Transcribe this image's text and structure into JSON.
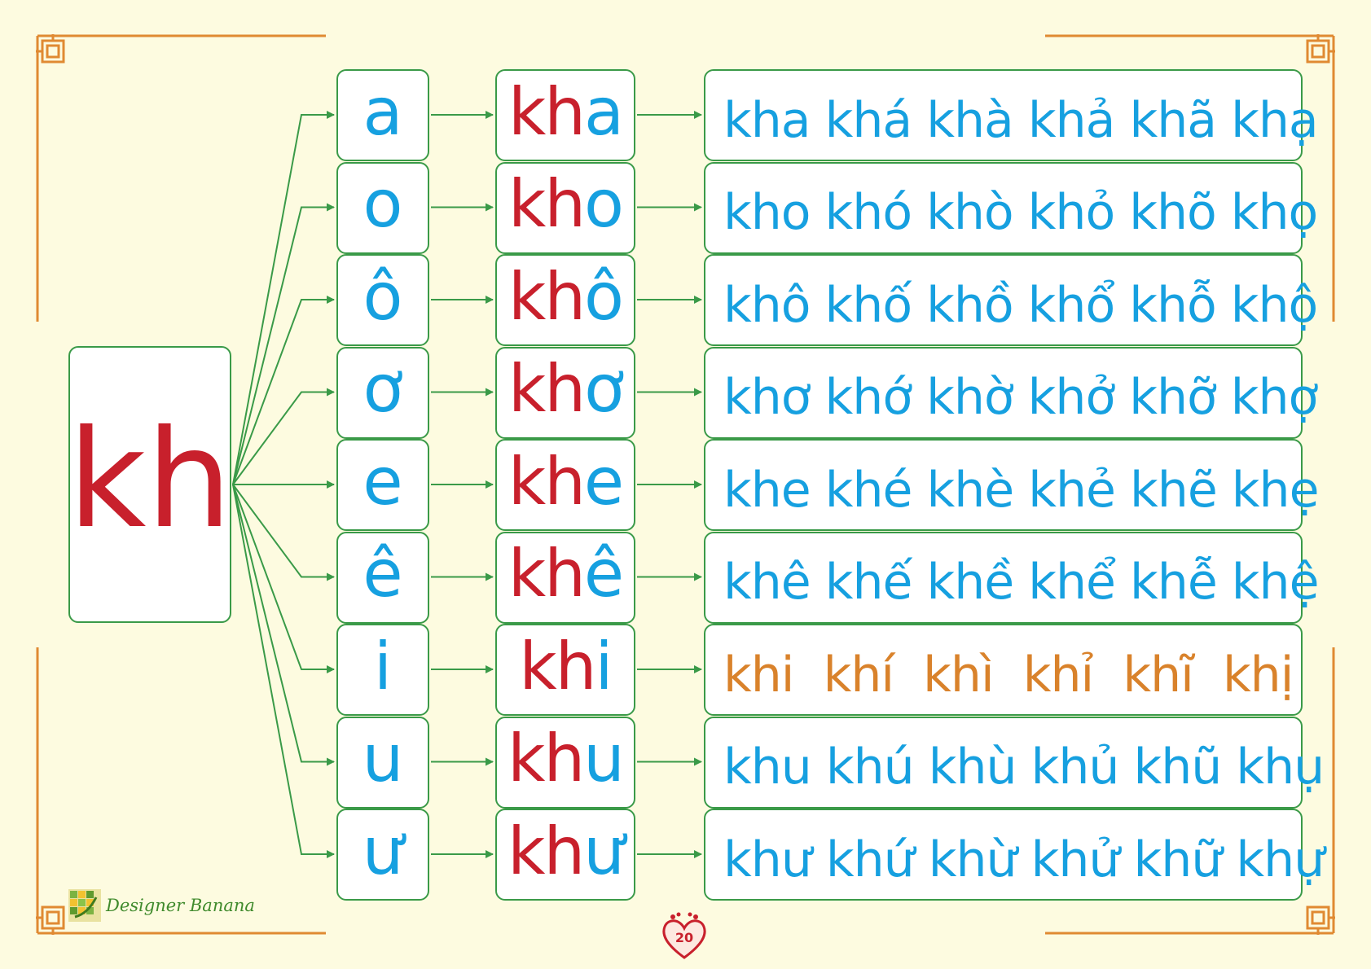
{
  "colors": {
    "background": "#fdfbe0",
    "consonant_red": "#c8202c",
    "vowel_blue": "#16a0e0",
    "highlight_orange": "#d9822b",
    "border_green": "#3a9a48",
    "frame_orange": "#e08a32"
  },
  "consonant": "kh",
  "rows": [
    {
      "vowel": "a",
      "syllable_kh": "kh",
      "syllable_vowel": "a",
      "tones": "kha khá khà khả khã khạ",
      "color": "#16a0e0"
    },
    {
      "vowel": "o",
      "syllable_kh": "kh",
      "syllable_vowel": "o",
      "tones": "kho khó khò khỏ khõ khọ",
      "color": "#16a0e0"
    },
    {
      "vowel": "ô",
      "syllable_kh": "kh",
      "syllable_vowel": "ô",
      "tones": "khô khố khồ khổ khỗ khộ",
      "color": "#16a0e0"
    },
    {
      "vowel": "ơ",
      "syllable_kh": "kh",
      "syllable_vowel": "ơ",
      "tones": "khơ khớ khờ khở khỡ khợ",
      "color": "#16a0e0"
    },
    {
      "vowel": "e",
      "syllable_kh": "kh",
      "syllable_vowel": "e",
      "tones": "khe khé khè khẻ khẽ khẹ",
      "color": "#16a0e0"
    },
    {
      "vowel": "ê",
      "syllable_kh": "kh",
      "syllable_vowel": "ê",
      "tones": "khê khế khề khể khễ khệ",
      "color": "#16a0e0"
    },
    {
      "vowel": "i",
      "syllable_kh": "kh",
      "syllable_vowel": "i",
      "tones": "khi  khí  khì  khỉ  khĩ  khị",
      "color": "#d9822b"
    },
    {
      "vowel": "u",
      "syllable_kh": "kh",
      "syllable_vowel": "u",
      "tones": "khu khú khù khủ khũ khụ",
      "color": "#16a0e0"
    },
    {
      "vowel": "ư",
      "syllable_kh": "kh",
      "syllable_vowel": "ư",
      "tones": "khư khứ khừ khử khữ khự",
      "color": "#16a0e0"
    }
  ],
  "logo": {
    "text": "Designer Banana",
    "icon": "banana-mosaic-icon"
  },
  "page_number": "20",
  "page_number_icon": "heart-footprints-icon"
}
